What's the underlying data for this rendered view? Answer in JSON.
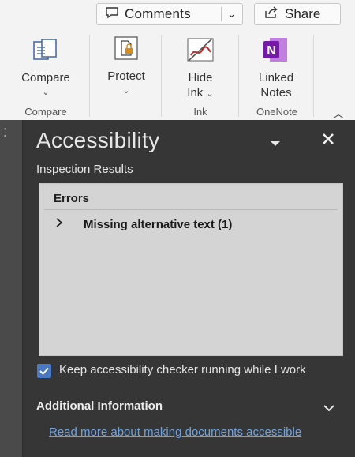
{
  "toolbar": {
    "comments_label": "Comments",
    "share_label": "Share"
  },
  "ribbon": {
    "compare_button": "Compare",
    "protect_button": "Protect",
    "hide_ink_button_line1": "Hide",
    "hide_ink_button_line2": "Ink",
    "linked_notes_line1": "Linked",
    "linked_notes_line2": "Notes",
    "groups": {
      "compare": "Compare",
      "ink": "Ink",
      "onenote": "OneNote"
    }
  },
  "pane": {
    "title": "Accessibility",
    "inspection_label": "Inspection Results",
    "errors_header": "Errors",
    "error_item": "Missing alternative text (1)",
    "keep_running": "Keep accessibility checker running while I work",
    "additional_info": "Additional Information",
    "read_more": "Read more about making documents accessible",
    "keep_running_checked": true
  },
  "colors": {
    "pane_bg": "#363636",
    "results_bg": "#d4d4d4",
    "link": "#6fa3e0",
    "checkbox": "#4a78c2",
    "onenote": "#7719aa"
  }
}
